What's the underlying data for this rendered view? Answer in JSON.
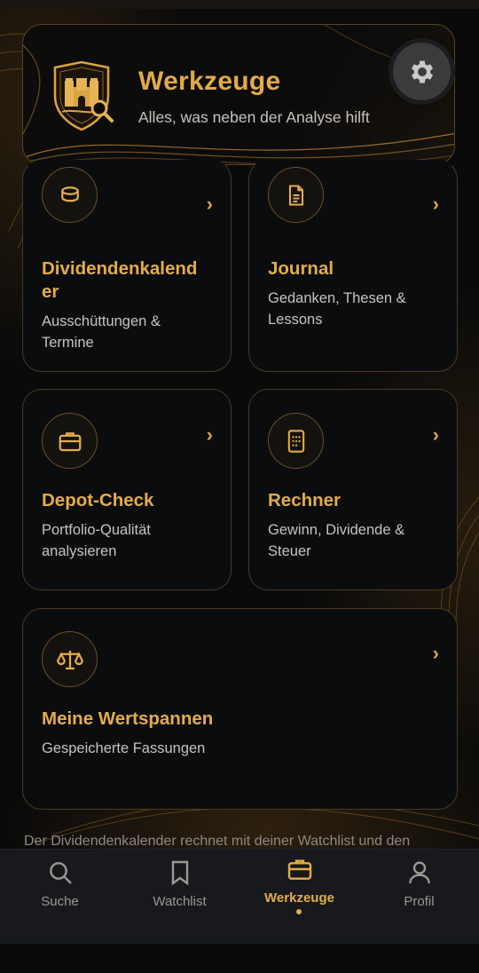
{
  "header": {
    "title": "Werkzeuge",
    "subtitle": "Alles, was neben der Analyse hilft",
    "settings_icon": "gear-icon",
    "crest_icon": "castle-shield-magnifier-icon"
  },
  "tools": [
    {
      "title_line1": "Dividendenkalend",
      "title_line2": "er",
      "desc_line1": "Ausschüttungen &",
      "desc_line2": "Termine",
      "icon": "coin-stack-icon"
    },
    {
      "title": "Journal",
      "desc_line1": "Gedanken, Thesen &",
      "desc_line2": "Lessons",
      "icon": "document-icon"
    },
    {
      "title": "Depot-Check",
      "desc_line1": "Portfolio-Qualität",
      "desc_line2": "analysieren",
      "icon": "briefcase-icon"
    },
    {
      "title": "Rechner",
      "desc_line1": "Gewinn, Dividende &",
      "desc_line2": "Steuer",
      "icon": "calculator-icon"
    },
    {
      "title": "Meine Wertspannen",
      "desc": "Gespeicherte Fassungen",
      "icon": "scales-icon"
    }
  ],
  "chevron": "›",
  "footnote": "Der Dividendenkalender rechnet mit deiner Watchlist und den",
  "nav": {
    "items": [
      {
        "label": "Suche",
        "icon": "search-icon"
      },
      {
        "label": "Watchlist",
        "icon": "bookmark-icon"
      },
      {
        "label": "Werkzeuge",
        "icon": "briefcase-icon",
        "active": true
      },
      {
        "label": "Profil",
        "icon": "user-icon"
      }
    ]
  },
  "colors": {
    "accent": "#e3ac4a",
    "background": "#0a0a0a",
    "card_border": "#4a3a22",
    "nav_bg": "#17191c"
  }
}
